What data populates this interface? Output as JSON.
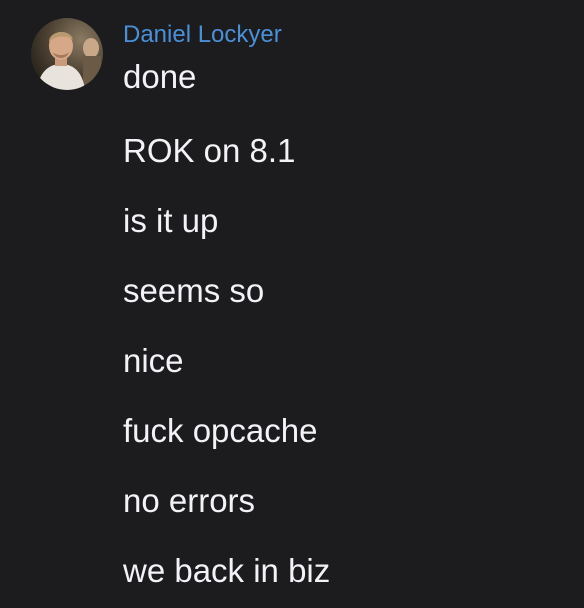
{
  "theme": {
    "background": "#1c1c1e",
    "sender_color": "#4a90d9",
    "text_color": "#f2f2f7"
  },
  "sender": {
    "name": "Daniel Lockyer",
    "avatar_icon": "user-avatar-photo"
  },
  "messages": [
    "done",
    "ROK on 8.1",
    "is it up",
    "seems so",
    "nice",
    "fuck opcache",
    "no errors",
    "we back in biz"
  ]
}
